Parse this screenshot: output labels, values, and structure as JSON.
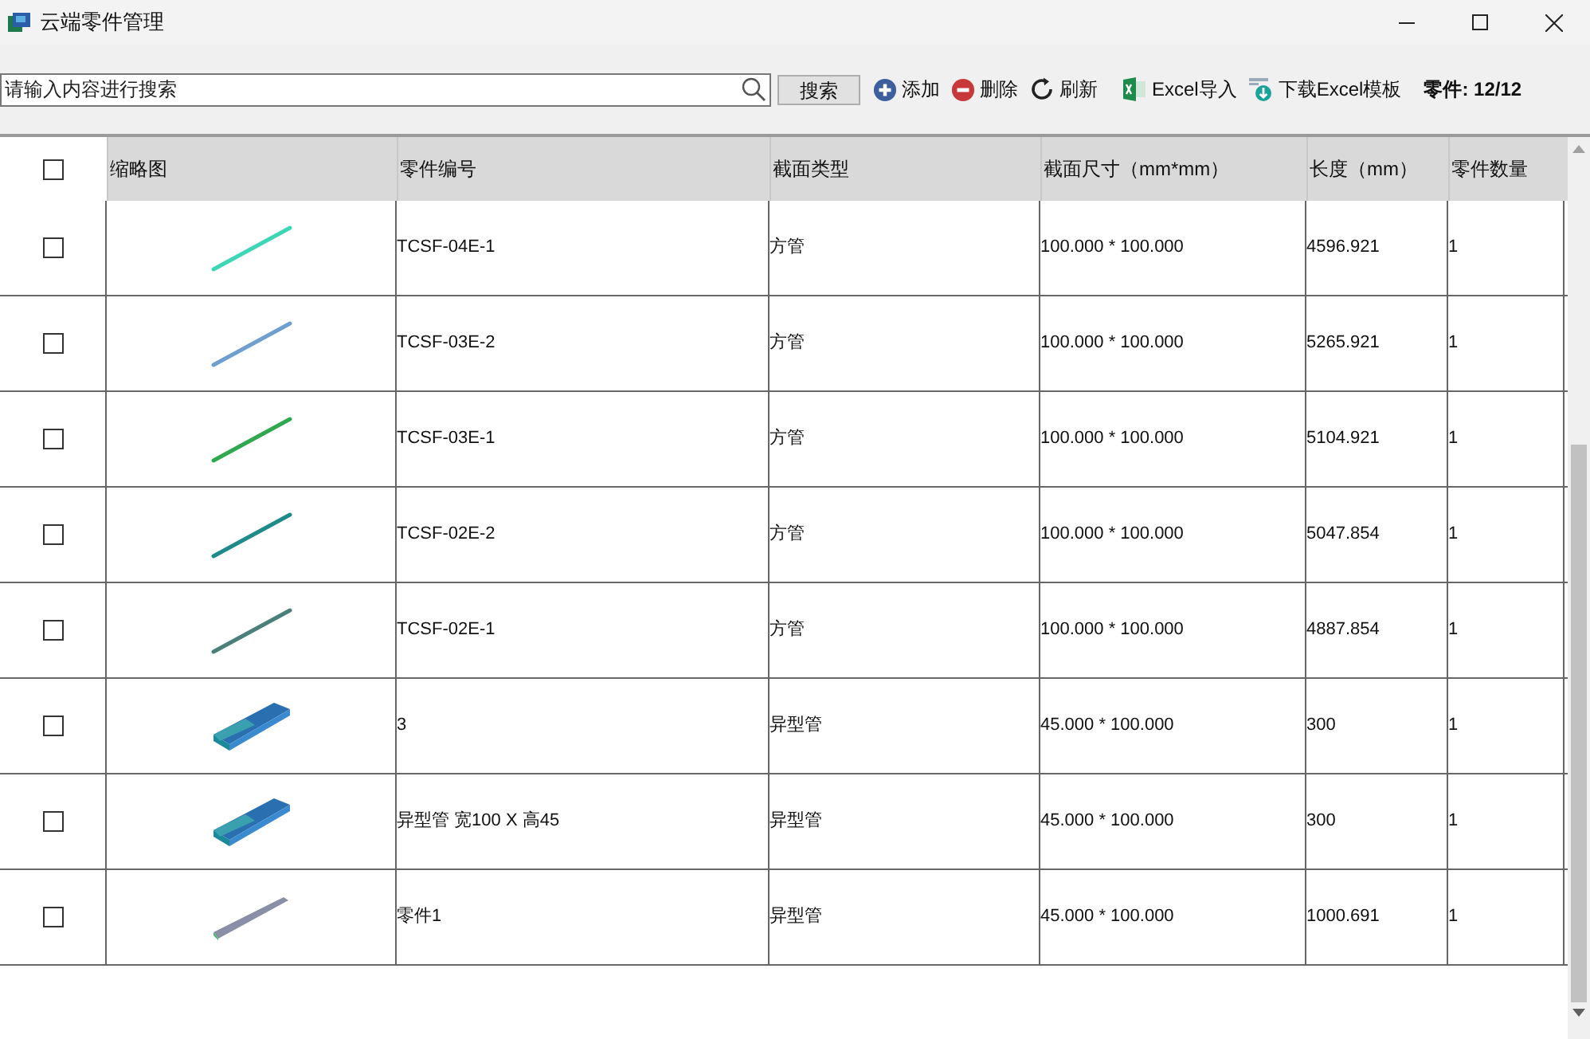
{
  "window": {
    "title": "云端零件管理"
  },
  "toolbar": {
    "search": {
      "placeholder": "请输入内容进行搜索"
    },
    "search_button": "搜索",
    "actions": [
      {
        "kind": "add",
        "label": "添加"
      },
      {
        "kind": "delete",
        "label": "删除"
      },
      {
        "kind": "refresh",
        "label": "刷新"
      },
      {
        "kind": "excel",
        "label": "Excel导入"
      },
      {
        "kind": "download",
        "label": "下载Excel模板"
      }
    ],
    "count": "零件: 12/12"
  },
  "table": {
    "header_checked": false,
    "columns": [
      "缩略图",
      "零件编号",
      "截面类型",
      "截面尺寸（mm*mm）",
      "长度（mm）",
      "零件数量"
    ],
    "rows": [
      {
        "checked": false,
        "cells": [
          {
            "kind": "line",
            "color": "#3fd6b8"
          },
          "TCSF-04E-1",
          "方管",
          "100.000 * 100.000",
          "4596.921",
          "1"
        ]
      },
      {
        "checked": false,
        "cells": [
          {
            "kind": "line",
            "color": "#6f9fd0"
          },
          "TCSF-03E-2",
          "方管",
          "100.000 * 100.000",
          "5265.921",
          "1"
        ]
      },
      {
        "checked": false,
        "cells": [
          {
            "kind": "line",
            "color": "#2fa84f"
          },
          "TCSF-03E-1",
          "方管",
          "100.000 * 100.000",
          "5104.921",
          "1"
        ]
      },
      {
        "checked": false,
        "cells": [
          {
            "kind": "line",
            "color": "#1f8a8a"
          },
          "TCSF-02E-2",
          "方管",
          "100.000 * 100.000",
          "5047.854",
          "1"
        ]
      },
      {
        "checked": false,
        "cells": [
          {
            "kind": "line",
            "color": "#4a7f7a"
          },
          "TCSF-02E-1",
          "方管",
          "100.000 * 100.000",
          "4887.854",
          "1"
        ]
      },
      {
        "checked": false,
        "cells": [
          {
            "kind": "beam",
            "color": "#2a6fb0"
          },
          "3",
          "异型管",
          "45.000 * 100.000",
          "300",
          "1"
        ]
      },
      {
        "checked": false,
        "cells": [
          {
            "kind": "beam",
            "color": "#2a6fb0"
          },
          "异型管 宽100 X 高45",
          "异型管",
          "45.000 * 100.000",
          "300",
          "1"
        ]
      },
      {
        "checked": false,
        "cells": [
          {
            "kind": "bar",
            "color": "#8a8fa8"
          },
          "零件1",
          "异型管",
          "45.000 * 100.000",
          "1000.691",
          "1"
        ]
      }
    ]
  }
}
